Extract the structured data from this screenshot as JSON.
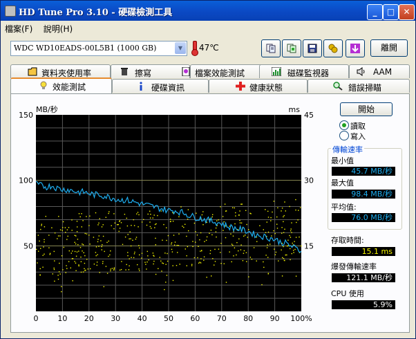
{
  "window": {
    "title": "HD Tune Pro 3.10 - 硬碟檢測工具"
  },
  "menu": [
    {
      "label": "檔案(F)"
    },
    {
      "label": "說明(H)"
    }
  ],
  "toolbar": {
    "drive": "WDC WD10EADS-00L5B1 (1000 GB)",
    "temperature": "47℃",
    "buttons": [
      "copy-text-icon",
      "copy-screenshot-icon",
      "save-icon",
      "options-icon",
      "download-icon"
    ],
    "exit_label": "離開"
  },
  "tabs_row1": [
    {
      "label": "資料夾使用率",
      "icon": "folder-icon"
    },
    {
      "label": "擦寫",
      "icon": "trash-icon"
    },
    {
      "label": "檔案效能測試",
      "icon": "file-benchmark-icon"
    },
    {
      "label": "磁碟監視器",
      "icon": "monitor-icon"
    },
    {
      "label": "AAM",
      "icon": "speaker-icon"
    }
  ],
  "tabs_row2": [
    {
      "label": "效能測試",
      "icon": "benchmark-icon",
      "active": true
    },
    {
      "label": "硬碟資訊",
      "icon": "info-icon"
    },
    {
      "label": "健康狀態",
      "icon": "health-cross-icon"
    },
    {
      "label": "錯誤掃瞄",
      "icon": "magnifier-icon"
    }
  ],
  "controls": {
    "start_label": "開始",
    "mode_read": "讀取",
    "mode_write": "寫入",
    "selected_mode": "讀取"
  },
  "stats": {
    "transfer_rate_title": "傳輸速率",
    "min_label": "最小值",
    "min_value": "45.7 MB/秒",
    "max_label": "最大值",
    "max_value": "98.4 MB/秒",
    "avg_label": "平均值:",
    "avg_value": "76.0 MB/秒",
    "access_label": "存取時間:",
    "access_value": "15.1 ms",
    "burst_label": "爆發傳輸速率",
    "burst_value": "121.1 MB/秒",
    "cpu_label": "CPU 使用",
    "cpu_value": "5.9%"
  },
  "colors": {
    "transfer_line": "#1eaef0",
    "access_points": "#f7f700",
    "plot_bg": "#000000",
    "grid": "#5a5a5a"
  },
  "chart_data": {
    "type": "line",
    "ylabel_left": "MB/秒",
    "ylabel_right": "ms",
    "ylim_left": [
      0,
      150
    ],
    "ylim_right": [
      0,
      45
    ],
    "yticks_left": [
      "150",
      "100",
      "50"
    ],
    "yticks_right": [
      "45",
      "30",
      "15"
    ],
    "xlim": [
      0,
      100
    ],
    "xticks": [
      "0",
      "10",
      "20",
      "30",
      "40",
      "50",
      "60",
      "70",
      "80",
      "90",
      "100%"
    ],
    "grid": true,
    "series": [
      {
        "type": "line",
        "x": [
          0,
          2,
          4,
          6,
          8,
          10,
          12,
          14,
          16,
          18,
          20,
          22,
          24,
          26,
          28,
          30,
          32,
          34,
          36,
          38,
          40,
          42,
          44,
          46,
          48,
          50,
          52,
          54,
          56,
          58,
          60,
          62,
          64,
          66,
          68,
          70,
          72,
          74,
          76,
          78,
          80,
          82,
          84,
          86,
          88,
          90,
          92,
          94,
          96,
          98,
          100
        ],
        "values": [
          97,
          96,
          95,
          96,
          94,
          93,
          93,
          92,
          91,
          91,
          90,
          89,
          89,
          88,
          87,
          86,
          85,
          85,
          84,
          83,
          82,
          81,
          80,
          79,
          78,
          77,
          77,
          76,
          75,
          73,
          72,
          71,
          70,
          69,
          68,
          67,
          65,
          64,
          63,
          62,
          61,
          59,
          58,
          57,
          56,
          55,
          53,
          52,
          50,
          48,
          46
        ]
      }
    ],
    "scatter_note_series": "access_time",
    "access_time_ms_center": 15.1
  }
}
